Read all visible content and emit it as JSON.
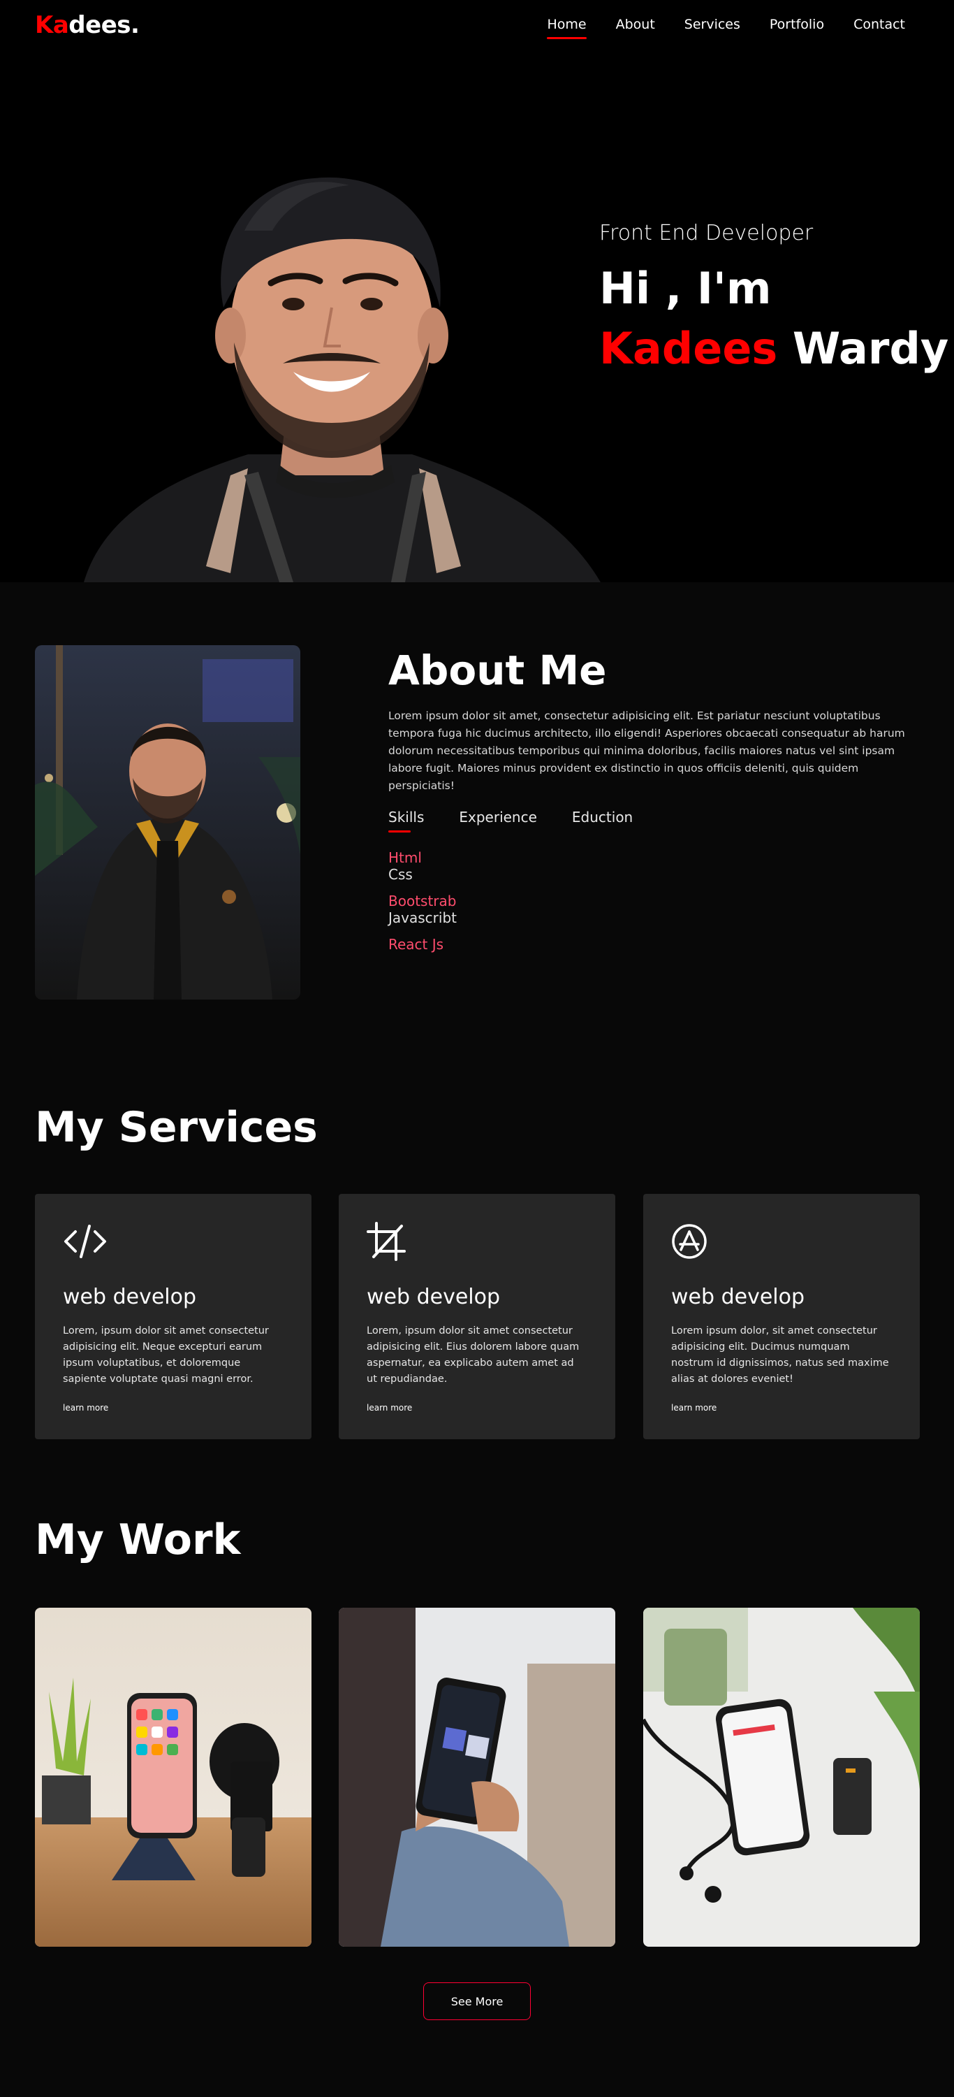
{
  "logo": {
    "accent": "Ka",
    "rest": "dees."
  },
  "nav": {
    "items": [
      {
        "label": "Home"
      },
      {
        "label": "About"
      },
      {
        "label": "Services"
      },
      {
        "label": "Portfolio"
      },
      {
        "label": "Contact"
      }
    ],
    "active": "Home"
  },
  "hero": {
    "role": "Front End Developer",
    "greeting": "Hi , I'm",
    "first_name": "Kadees",
    "last_name": "Wardy"
  },
  "about": {
    "title": "About Me",
    "body": "Lorem ipsum dolor sit amet, consectetur adipisicing elit. Est pariatur nesciunt voluptatibus tempora fuga hic ducimus architecto, illo eligendi! Asperiores obcaecati consequatur ab harum dolorum necessitatibus temporibus qui minima doloribus, facilis maiores natus vel sint ipsam labore fugit. Maiores minus provident ex distinctio in quos officiis deleniti, quis quidem perspiciatis!",
    "tabs": [
      {
        "label": "Skills"
      },
      {
        "label": "Experience"
      },
      {
        "label": "Eduction"
      }
    ],
    "skills": [
      {
        "name": "Html",
        "sub": "Css"
      },
      {
        "name": "Bootstrab",
        "sub": "Javascribt"
      },
      {
        "name": "React Js",
        "sub": ""
      }
    ]
  },
  "services": {
    "title": "My Services",
    "cards": [
      {
        "icon": "code-icon",
        "title": "web develop",
        "text": "Lorem, ipsum dolor sit amet consectetur adipisicing elit. Neque excepturi earum ipsum voluptatibus, et doloremque sapiente voluptate quasi magni error.",
        "link": "learn more"
      },
      {
        "icon": "crop-icon",
        "title": "web develop",
        "text": "Lorem, ipsum dolor sit amet consectetur adipisicing elit. Eius dolorem labore quam aspernatur, ea explicabo autem amet ad ut repudiandae.",
        "link": "learn more"
      },
      {
        "icon": "app-store-icon",
        "title": "web develop",
        "text": "Lorem ipsum dolor, sit amet consectetur adipisicing elit. Ducimus numquam nostrum id dignissimos, natus sed maxime alias at dolores eveniet!",
        "link": "learn more"
      }
    ]
  },
  "work": {
    "title": "My Work",
    "button": "See More"
  },
  "colors": {
    "accent": "#ff0000",
    "background": "#080808",
    "card": "#262626"
  }
}
